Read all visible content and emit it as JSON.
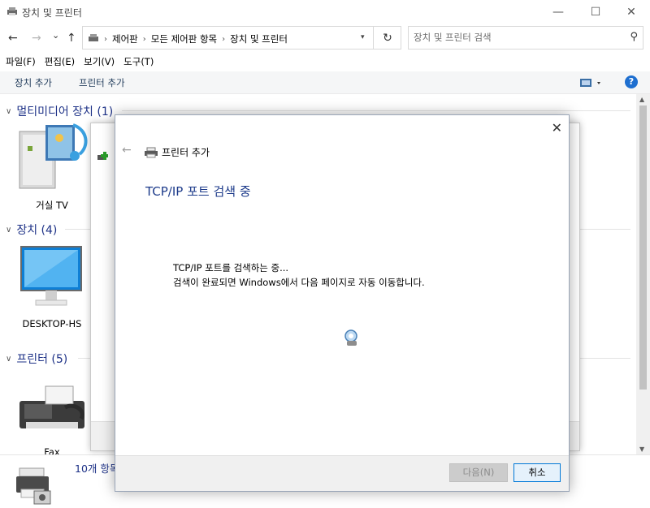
{
  "window": {
    "title": "장치 및 프린터",
    "minimize": "—",
    "maximize": "☐",
    "close": "✕"
  },
  "nav": {
    "back": "←",
    "forward": "→",
    "recent": "⌄",
    "up": "↑",
    "breadcrumbs": [
      "제어판",
      "모든 제어판 항목",
      "장치 및 프린터"
    ],
    "search_placeholder": "장치 및 프린터 검색"
  },
  "menu": [
    "파일(F)",
    "편집(E)",
    "보기(V)",
    "도구(T)"
  ],
  "commands": {
    "add_device": "장치 추가",
    "add_printer": "프린터 추가"
  },
  "groups": {
    "multimedia": {
      "label": "멀티미디어 장치 (1)",
      "device": "거실 TV"
    },
    "devices": {
      "label": "장치 (4)",
      "device": "DESKTOP-HS"
    },
    "printers": {
      "label": "프린터 (5)",
      "device": "Fax"
    }
  },
  "status": {
    "count": "10개 항목"
  },
  "dialog": {
    "close": "✕",
    "back": "←",
    "title": "프린터 추가",
    "heading": "TCP/IP 포트 검색 중",
    "message_line1": "TCP/IP 포트를 검색하는 중...",
    "message_line2": "검색이 완료되면 Windows에서 다음 페이지로 자동 이동합니다.",
    "next_button": "다음(N)",
    "cancel_button": "취소"
  },
  "colors": {
    "link_blue": "#1e3287",
    "heading_blue": "#1c3a8a",
    "accent": "#0078d7"
  }
}
